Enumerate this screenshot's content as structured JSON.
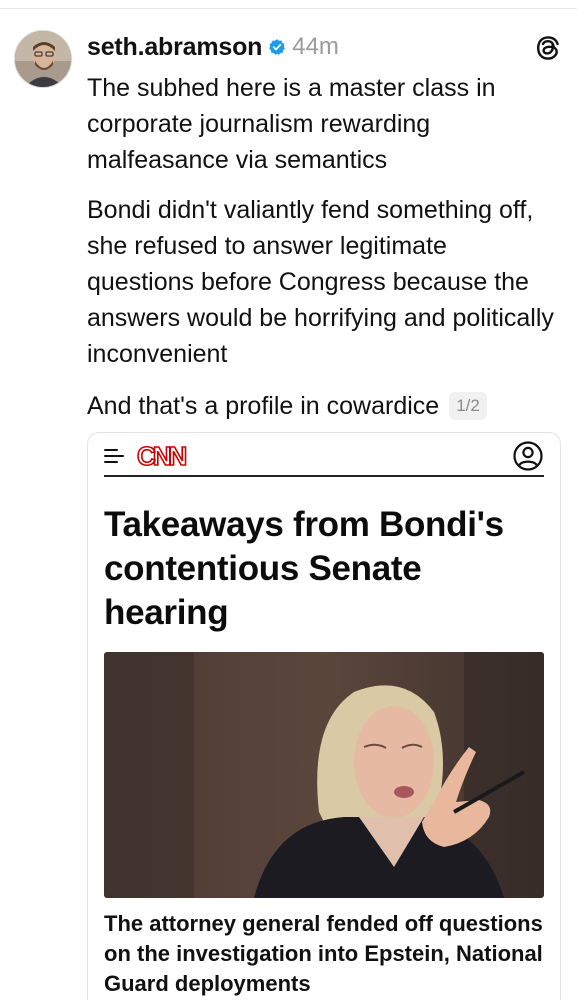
{
  "post": {
    "username": "seth.abramson",
    "timestamp": "44m",
    "avatar_icon": "user-avatar-photo",
    "verified_icon": "verified-badge-icon",
    "app_icon": "threads-icon",
    "verified_color": "#1d9bf0",
    "paragraphs": [
      "The subhed here is a master class in corporate journalism rewarding malfeasance via semantics",
      "Bondi didn't valiantly fend something off, she refused to answer legitimate questions before Congress because the answers would be horrifying and politically inconvenient",
      "And that's a profile in cowardice"
    ],
    "page_count": "1/2"
  },
  "embed": {
    "site_logo": "CNN",
    "logo_color": "#cc0000",
    "menu_icon": "hamburger-menu-icon",
    "account_icon": "account-circle-icon",
    "headline": "Takeaways from Bondi's contentious Senate hearing",
    "image_icon": "hearing-photo",
    "subhed": "The attorney general fended off questions on the investigation into Epstein, National Guard deployments"
  }
}
